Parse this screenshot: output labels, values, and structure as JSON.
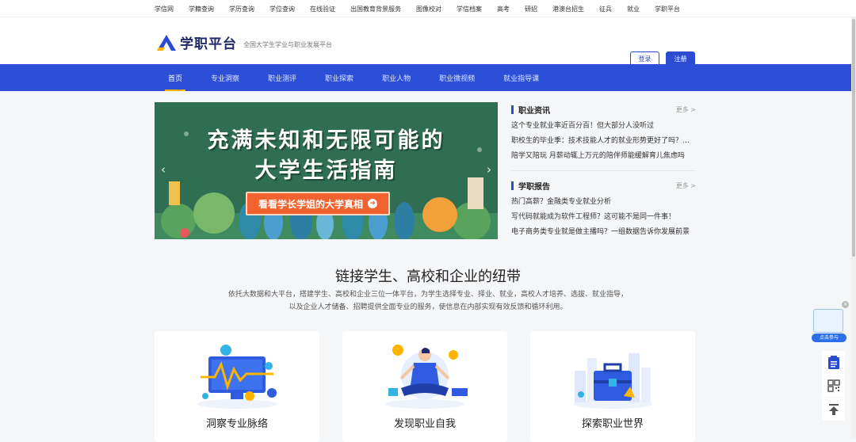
{
  "topbar": {
    "links": [
      "学信网",
      "学籍查询",
      "学历查询",
      "学位查询",
      "在线验证",
      "出国教育背景服务",
      "图像校对",
      "学信档案",
      "高考",
      "研招",
      "港澳台招生",
      "征兵",
      "就业",
      "学职平台"
    ]
  },
  "header": {
    "logo_text": "学职平台",
    "slogan": "全国大学生学业与职业发展平台",
    "login_label": "登录",
    "register_label": "注册"
  },
  "nav": {
    "items": [
      "首页",
      "专业洞察",
      "职业测评",
      "职业探索",
      "职业人物",
      "职业微视频",
      "就业指导课"
    ],
    "active": 0
  },
  "banner": {
    "line1": "充满未知和无限可能的",
    "line2": "大学生活指南",
    "cta": "看看学长学姐的大学真相"
  },
  "news": {
    "title": "职业资讯",
    "more": "更多 >",
    "items": [
      "这个专业就业率近百分百！但大部分人没听过",
      "职校生的毕业季：技术技能人才的就业形势更好了吗？（二）",
      "陪学又陪玩 月薪动辄上万元的陪伴师能缓解育儿焦虑吗"
    ]
  },
  "reports": {
    "title": "学职报告",
    "more": "更多 >",
    "items": [
      "热门高薪？金融类专业就业分析",
      "写代码就能成为软件工程师？这可能不是同一件事！",
      "电子商务类专业就是做主播吗？一组数据告诉你发展前景"
    ]
  },
  "section": {
    "title": "链接学生、高校和企业的纽带",
    "desc_line1": "依托大数据和大平台，搭建学生、高校和企业三位一体平台，为学生选择专业、择业、就业，高校人才培养、选拔、就业指导，",
    "desc_line2": "以及企业人才储备、招聘提供全面专业的服务，使信息在内部实现有效反馈和循环利用。"
  },
  "cards": [
    {
      "caption": "洞察专业脉络",
      "icon": "monitor-chart-icon"
    },
    {
      "caption": "发现职业自我",
      "icon": "meditation-person-icon"
    },
    {
      "caption": "探索职业世界",
      "icon": "briefcase-city-icon"
    }
  ],
  "float_ad": {
    "label": "点击参与"
  },
  "colors": {
    "brand": "#2d4fd8",
    "accent": "#ffb400",
    "cta": "#f2622e"
  }
}
